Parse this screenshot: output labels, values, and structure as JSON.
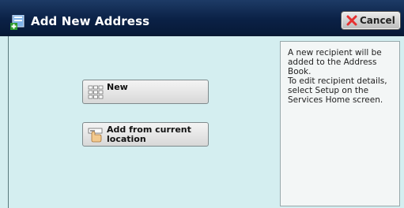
{
  "titlebar": {
    "title": "Add New Address",
    "title_icon": "add-address-icon",
    "cancel_label": "Cancel",
    "cancel_icon": "red-x-icon"
  },
  "main": {
    "buttons": [
      {
        "label": "New",
        "icon": "keypad-icon"
      },
      {
        "label": "Add from current\nlocation",
        "icon": "hand-card-icon"
      }
    ]
  },
  "info": {
    "paragraph1": "A new recipient will be added to the Address Book.",
    "paragraph2": "To edit recipient details, select Setup on the Services Home screen."
  },
  "colors": {
    "titlebar": "#0b2146",
    "background": "#d4eef0",
    "cancel_x": "#e63030"
  }
}
